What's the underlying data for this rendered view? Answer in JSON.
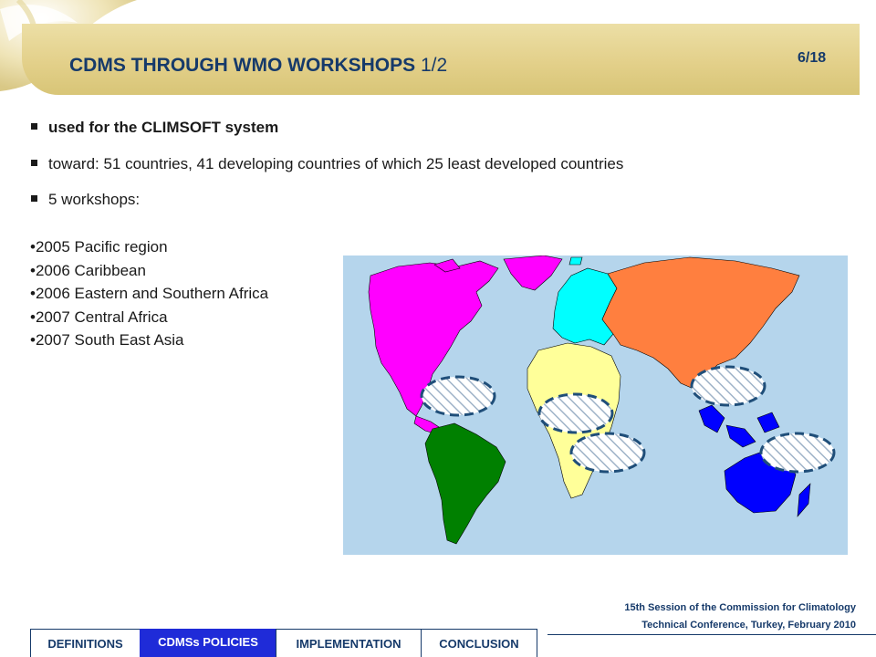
{
  "slide": {
    "title_main": "CDMS THROUGH WMO WORKSHOPS",
    "title_suffix": "1/2",
    "page_number": "6/18"
  },
  "bullets": [
    "used for the CLIMSOFT system",
    "toward: 51 countries, 41 developing countries of which 25 least developed countries",
    "5 workshops:"
  ],
  "workshops": [
    "2005 Pacific region",
    "2006 Caribbean",
    "2006 Eastern and Southern Africa",
    "2007 Central Africa",
    "2007 South East Asia"
  ],
  "footer": {
    "line1": "15th Session of the Commission for Climatology",
    "line2": "Technical Conference, Turkey, February 2010"
  },
  "tabs": [
    {
      "label": "DEFINITIONS",
      "active": false
    },
    {
      "label": "CDMSs POLICIES",
      "active": true
    },
    {
      "label": "IMPLEMENTATION",
      "active": false
    },
    {
      "label": "CONCLUSION",
      "active": false
    }
  ],
  "colors": {
    "title_text": "#163a6a",
    "title_band": "#e3d08a",
    "ocean": "#b5d5ec",
    "north_america": "#ff00ff",
    "south_america": "#008000",
    "europe": "#00ffff",
    "asia": "#ff7f3f",
    "africa": "#ffff99",
    "oceania": "#0000ff",
    "highlight_outline": "#1f4e79",
    "active_tab": "#1f2bd8"
  },
  "icons": [
    "swirl-decoration",
    "bullet-square",
    "world-map",
    "hatched-region-marker"
  ]
}
